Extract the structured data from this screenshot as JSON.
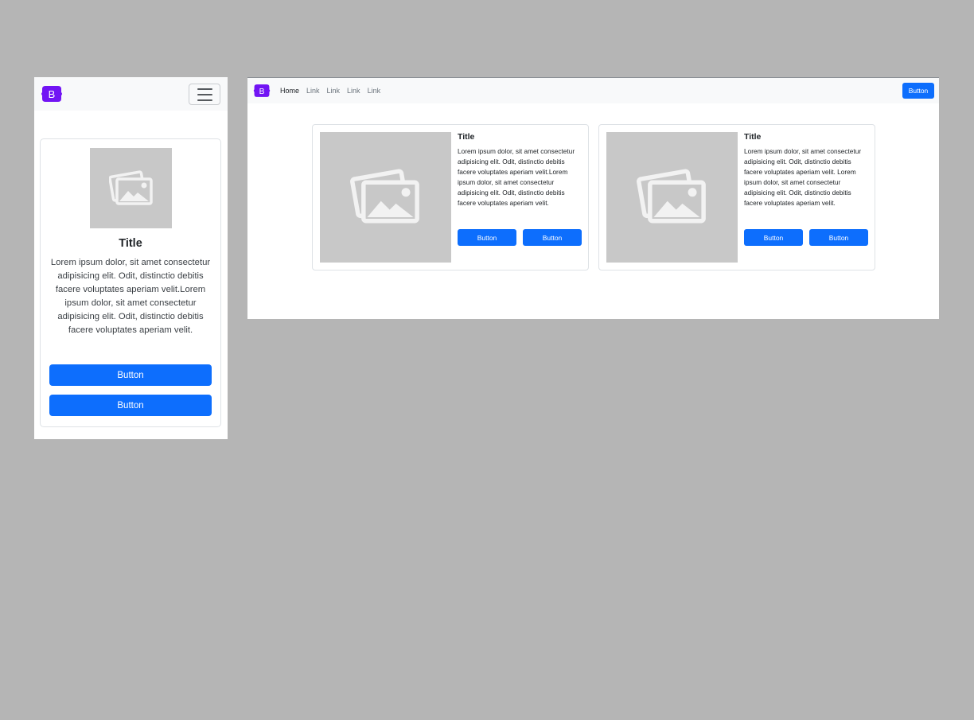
{
  "colors": {
    "canvas": "#b5b5b5",
    "brand": "#7214f4",
    "primary": "#0d6efd",
    "navbar": "#f8f9fa",
    "placeholder": "#c8c8c8"
  },
  "brand": {
    "letter": "B",
    "icon": "bootstrap-logo-icon"
  },
  "mobile": {
    "toggler_icon": "hamburger-menu-icon",
    "card": {
      "image_icon": "image-placeholder-icon",
      "title": "Title",
      "text": "Lorem ipsum dolor, sit amet consectetur adipisicing elit. Odit, distinctio debitis facere voluptates aperiam velit.Lorem ipsum dolor, sit amet consectetur adipisicing elit. Odit, distinctio debitis facere voluptates aperiam velit.",
      "button1": "Button",
      "button2": "Button"
    }
  },
  "desktop": {
    "nav": {
      "links": [
        "Home",
        "Link",
        "Link",
        "Link",
        "Link"
      ],
      "button": "Button"
    },
    "cards": [
      {
        "image_icon": "image-placeholder-icon",
        "title": "Title",
        "text": "Lorem ipsum dolor, sit amet consectetur adipisicing elit. Odit, distinctio debitis facere voluptates aperiam velit.Lorem ipsum dolor, sit amet consectetur adipisicing elit. Odit, distinctio debitis facere voluptates aperiam velit.",
        "button1": "Button",
        "button2": "Button"
      },
      {
        "image_icon": "image-placeholder-icon",
        "title": "Title",
        "text": "Lorem ipsum dolor, sit amet consectetur adipisicing elit. Odit, distinctio debitis facere voluptates aperiam velit. Lorem ipsum dolor, sit amet consectetur adipisicing elit. Odit, distinctio debitis facere voluptates aperiam velit.",
        "button1": "Button",
        "button2": "Button"
      }
    ]
  }
}
